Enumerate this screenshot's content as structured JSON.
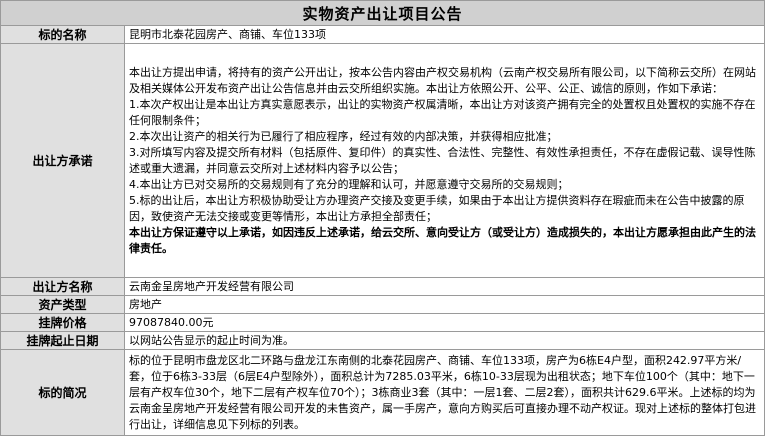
{
  "title": "实物资产出让项目公告",
  "rows": {
    "subject": {
      "label": "标的名称",
      "value": "昆明市北泰花园房产、商铺、车位133项"
    },
    "promise": {
      "label": "出让方承诺",
      "lines": [
        "本出让方提出申请，将持有的资产公开出让，按本公告内容由产权交易机构（云南产权交易所有限公司，以下简称云交所）在网站及相关媒体公开发布资产出让公告信息并由云交所组织实施。本出让方依照公开、公平、公正、诚信的原则，作如下承诺：",
        "1.本次产权出让是本出让方真实意愿表示，出让的实物资产权属清晰，本出让方对该资产拥有完全的处置权且处置权的实施不存在任何限制条件；",
        "2.本次出让资产的相关行为已履行了相应程序，经过有效的内部决策，并获得相应批准；",
        "3.对所填写内容及提交所有材料（包括原件、复印件）的真实性、合法性、完整性、有效性承担责任，不存在虚假记载、误导性陈述或重大遗漏，并同意云交所对上述材料内容予以公告；",
        "4.本出让方已对交易所的交易规则有了充分的理解和认可，并愿意遵守交易所的交易规则；",
        "5.标的出让后，本出让方积极协助受让方办理资产交接及变更手续，如果由于本出让方提供资料存在瑕疵而未在公告中披露的原因，致使资产无法交接或变更等情形，本出让方承担全部责任；"
      ],
      "bold_text": "本出让方保证遵守以上承诺，如因违反上述承诺，给云交所、意向受让方（或受让方）造成损失的，本出让方愿承担由此产生的法律责任。"
    },
    "seller": {
      "label": "出让方名称",
      "value": "云南金呈房地产开发经营有限公司"
    },
    "asset_type": {
      "label": "资产类型",
      "value": "房地产"
    },
    "price": {
      "label": "挂牌价格",
      "value": "97087840.00元"
    },
    "dates": {
      "label": "挂牌起止日期",
      "value": "以网站公告显示的起止时间为准。"
    },
    "summary": {
      "label": "标的简况",
      "value": "标的位于昆明市盘龙区北二环路与盘龙江东南侧的北泰花园房产、商铺、车位133项，房产为6栋E4户型，面积242.97平方米/套，位于6栋3-33层（6层E4户型除外），面积总计为7285.03平米，6栋10-33层现为出租状态；地下车位100个（其中：地下一层有产权车位30个，地下二层有产权车位70个）；3栋商业3套（其中：一层1套、二层2套），面积共计629.6平米。上述标的均为云南金呈房地产开发经营有限公司开发的未售资产，属一手房产，意向方购买后可直接办理不动产权证。现对上述标的整体打包进行出让，详细信息见下列标的列表。"
    }
  }
}
